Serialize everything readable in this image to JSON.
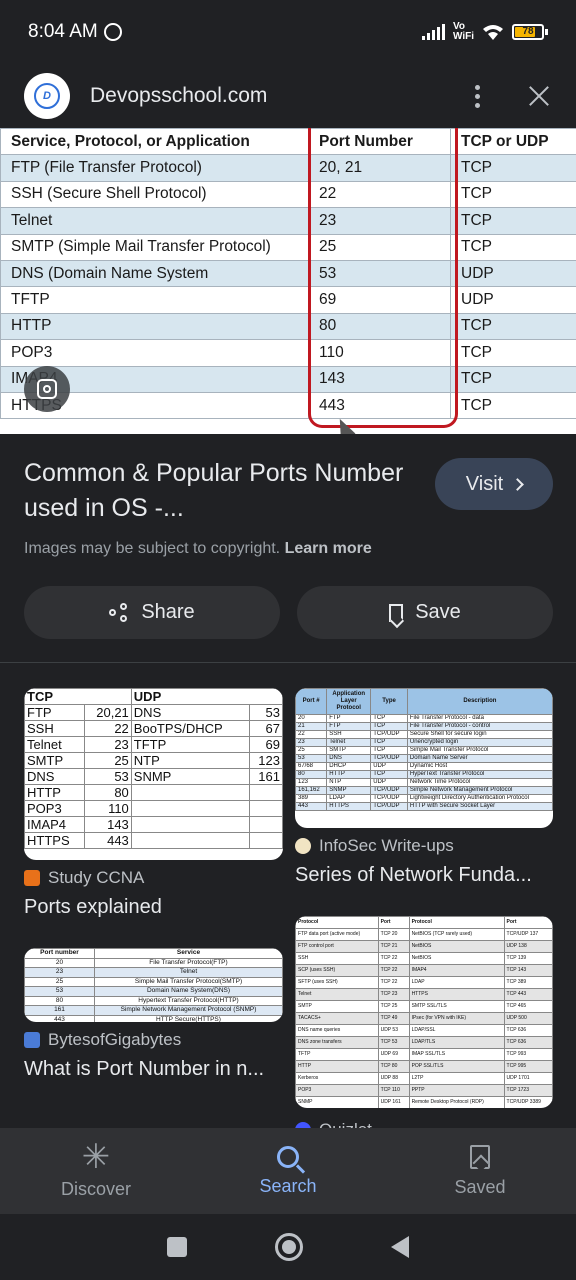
{
  "status_bar": {
    "time": "8:04 AM",
    "network": "Vo\nWiFi",
    "battery": "78"
  },
  "header": {
    "site_name": "Devopsschool.com",
    "logo_text": "D"
  },
  "main_table": {
    "headers": [
      "Service, Protocol, or Application",
      "Port Number",
      "TCP or UDP"
    ],
    "rows": [
      [
        "FTP (File Transfer Protocol)",
        "20, 21",
        "TCP"
      ],
      [
        "SSH (Secure Shell Protocol)",
        "22",
        "TCP"
      ],
      [
        "Telnet",
        "23",
        "TCP"
      ],
      [
        "SMTP (Simple Mail Transfer Protocol)",
        "25",
        "TCP"
      ],
      [
        "DNS (Domain Name System",
        "53",
        "UDP"
      ],
      [
        "TFTP",
        "69",
        "UDP"
      ],
      [
        "HTTP",
        "80",
        "TCP"
      ],
      [
        "POP3",
        "110",
        "TCP"
      ],
      [
        "IMAP4",
        "143",
        "TCP"
      ],
      [
        "HTTPS",
        "443",
        "TCP"
      ]
    ]
  },
  "result": {
    "title": "Common & Popular Ports Number used in OS -...",
    "visit_label": "Visit",
    "copyright": "Images may be subject to copyright.",
    "learn_more": "Learn more",
    "share_label": "Share",
    "save_label": "Save"
  },
  "related": [
    {
      "source": "Study CCNA",
      "title": "Ports explained",
      "tcp_header": "TCP",
      "udp_header": "UDP",
      "rows": [
        [
          "FTP",
          "20,21",
          "DNS",
          "53"
        ],
        [
          "SSH",
          "22",
          "BooTPS/DHCP",
          "67"
        ],
        [
          "Telnet",
          "23",
          "TFTP",
          "69"
        ],
        [
          "SMTP",
          "25",
          "NTP",
          "123"
        ],
        [
          "DNS",
          "53",
          "SNMP",
          "161"
        ],
        [
          "HTTP",
          "80",
          "",
          ""
        ],
        [
          "POP3",
          "110",
          "",
          ""
        ],
        [
          "IMAP4",
          "143",
          "",
          ""
        ],
        [
          "HTTPS",
          "443",
          "",
          ""
        ]
      ]
    },
    {
      "source": "InfoSec Write-ups",
      "title": "Series of Network Funda...",
      "headers": [
        "Port #",
        "Application Layer Protocol",
        "Type",
        "Description"
      ],
      "rows": [
        [
          "20",
          "FTP",
          "TCP",
          "File Transfer Protocol - data"
        ],
        [
          "21",
          "FTP",
          "TCP",
          "File Transfer Protocol - control"
        ],
        [
          "22",
          "SSH",
          "TCP/UDP",
          "Secure Shell for secure login"
        ],
        [
          "23",
          "Telnet",
          "TCP",
          "Unencrypted login"
        ],
        [
          "25",
          "SMTP",
          "TCP",
          "Simple Mail Transfer Protocol"
        ],
        [
          "53",
          "DNS",
          "TCP/UDP",
          "Domain Name Server"
        ],
        [
          "67/68",
          "DHCP",
          "UDP",
          "Dynamic Host"
        ],
        [
          "80",
          "HTTP",
          "TCP",
          "HyperText Transfer Protocol"
        ],
        [
          "123",
          "NTP",
          "UDP",
          "Network Time Protocol"
        ],
        [
          "161,162",
          "SNMP",
          "TCP/UDP",
          "Simple Network Management Protocol"
        ],
        [
          "389",
          "LDAP",
          "TCP/UDP",
          "Lightweight Directory Authentication Protocol"
        ],
        [
          "443",
          "HTTPS",
          "TCP/UDP",
          "HTTP with Secure Socket Layer"
        ]
      ]
    },
    {
      "source": "BytesofGigabytes",
      "title": "What is Port Number in n...",
      "headers": [
        "Port number",
        "Service"
      ],
      "rows": [
        [
          "20",
          "File Transfer Protocol(FTP)"
        ],
        [
          "23",
          "Telnet"
        ],
        [
          "25",
          "Simple Mail Transfer Protocol(SMTP)"
        ],
        [
          "53",
          "Domain Name System(DNS)"
        ],
        [
          "80",
          "Hypertext Transfer Protocol(HTTP)"
        ],
        [
          "161",
          "Simple Network Management Protocol (SNMP)"
        ],
        [
          "443",
          "HTTP Secure(HTTPS)"
        ]
      ]
    },
    {
      "source": "Quizlet",
      "headers": [
        "Protocol",
        "Port",
        "Protocol",
        "Port"
      ],
      "rows": [
        [
          "FTP data port (active mode)",
          "TCP 20",
          "NetBIOS (TCP rarely used)",
          "TCP/UDP 137"
        ],
        [
          "FTP control port",
          "TCP 21",
          "NetBIOS",
          "UDP 138"
        ],
        [
          "SSH",
          "TCP 22",
          "NetBIOS",
          "TCP 139"
        ],
        [
          "SCP (uses SSH)",
          "TCP 22",
          "IMAP4",
          "TCP 143"
        ],
        [
          "SFTP (uses SSH)",
          "TCP 22",
          "LDAP",
          "TCP 389"
        ],
        [
          "Telnet",
          "TCP 23",
          "HTTPS",
          "TCP 443"
        ],
        [
          "SMTP",
          "TCP 25",
          "SMTP SSL/TLS",
          "TCP 465"
        ],
        [
          "TACACS+",
          "TCP 49",
          "IPsec (for VPN with IKE)",
          "UDP 500"
        ],
        [
          "DNS name queries",
          "UDP 53",
          "LDAP/SSL",
          "TCP 636"
        ],
        [
          "DNS zone transfers",
          "TCP 53",
          "LDAP/TLS",
          "TCP 636"
        ],
        [
          "TFTP",
          "UDP 69",
          "IMAP SSL/TLS",
          "TCP 993"
        ],
        [
          "HTTP",
          "TCP 80",
          "POP SSL/TLS",
          "TCP 995"
        ],
        [
          "Kerberos",
          "UDP 88",
          "L2TP",
          "UDP 1701"
        ],
        [
          "POP3",
          "TCP 110",
          "PPTP",
          "TCP 1723"
        ],
        [
          "SNMP",
          "UDP 161",
          "Remote Desktop Protocol (RDP)",
          "TCP/UDP 3389"
        ],
        [
          "SNMP trap",
          "UDP 162",
          "Microsoft SQL Server",
          "TCP 1433"
        ]
      ]
    }
  ],
  "bottom_nav": {
    "discover": "Discover",
    "search": "Search",
    "saved": "Saved"
  },
  "colors": {
    "accent": "#8ab4f8",
    "background": "#202124",
    "highlight_box": "#c01820",
    "table_alt_row": "#d7e6ef"
  }
}
